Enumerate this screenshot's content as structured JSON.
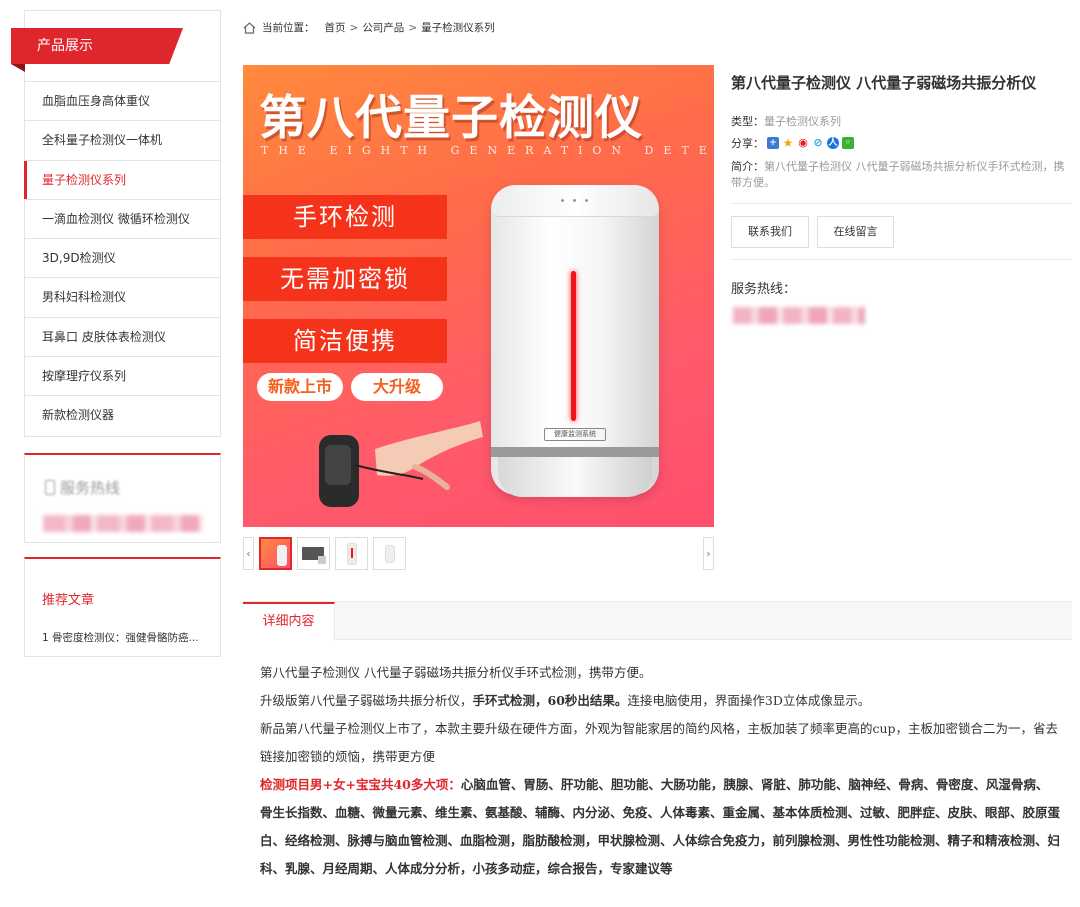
{
  "sidebar": {
    "category_title": "产品展示",
    "items": [
      {
        "label": "血脂血压身高体重仪"
      },
      {
        "label": "全科量子检测仪一体机"
      },
      {
        "label": "量子检测仪系列"
      },
      {
        "label": "一滴血检测仪 微循环检测仪"
      },
      {
        "label": "3D,9D检测仪"
      },
      {
        "label": "男科妇科检测仪"
      },
      {
        "label": "耳鼻口 皮肤体表检测仪"
      },
      {
        "label": "按摩理疗仪系列"
      },
      {
        "label": "新款检测仪器"
      }
    ],
    "active_index": 2,
    "hotline_title": "服务热线",
    "recommend_title": "推荐文章",
    "recommend_items": [
      "1 骨密度检测仪：强健骨骼防癌..."
    ]
  },
  "breadcrumb": {
    "prefix": "当前位置：",
    "items": [
      "首页",
      "公司产品",
      "量子检测仪系列"
    ],
    "separator": ">"
  },
  "image": {
    "title": "第八代量子检测仪",
    "subtitle": "THE EIGHTH GENERATION DETECTOR",
    "labels": [
      "手环检测",
      "无需加密锁",
      "简洁便携"
    ],
    "pills": [
      "新款上市",
      "大升级"
    ],
    "device_tag": "健康监测系统"
  },
  "gallery": {
    "prev": "‹",
    "next": "›",
    "thumb_count": 4,
    "selected": 0
  },
  "product": {
    "title": "第八代量子检测仪 八代量子弱磁场共振分析仪",
    "type_label": "类型：",
    "type_value": "量子检测仪系列",
    "share_label": "分享：",
    "intro_label": "简介：",
    "intro_value": "第八代量子检测仪 八代量子弱磁场共振分析仪手环式检测，携带方便。",
    "contact_button": "联系我们",
    "message_button": "在线留言",
    "hotline_label": "服务热线："
  },
  "detail": {
    "tab_label": "详细内容",
    "para1": "第八代量子检测仪  八代量子弱磁场共振分析仪手环式检测，携带方便。",
    "para2_a": "升级版第八代量子弱磁场共振分析仪，",
    "para2_b": "手环式检测，60秒出结果。",
    "para2_c": "连接电脑使用，界面操作3D立体成像显示。",
    "para3": "新品第八代量子检测仪上市了，本款主要升级在硬件方面，外观为智能家居的简约风格，主板加装了频率更高的cup，主板加密锁合二为一，省去链接加密锁的烦恼，携带更方便",
    "para4_red": "检测项目男+女+宝宝共40多大项：",
    "para4_bold": "心脑血管、胃肠、肝功能、胆功能、大肠功能，胰腺、肾脏、肺功能、脑神经、骨病、骨密度、风湿骨病、骨生长指数、血糖、微量元素、维生素、氨基酸、辅酶、内分泌、免疫、人体毒素、重金属、基本体质检测、过敏、肥胖症、皮肤、眼部、胶原蛋白、经络检测、脉搏与脑血管检测、血脂检测，脂肪酸检测，甲状腺检测、人体综合免疫力，前列腺检测、男性性功能检测、精子和精液检测、妇科、乳腺、月经周期、人体成分分析，小孩多动症，综合报告，专家建议等"
  },
  "colors": {
    "accent": "#e0262d",
    "muted": "#999999",
    "border": "#e4e4e4"
  }
}
